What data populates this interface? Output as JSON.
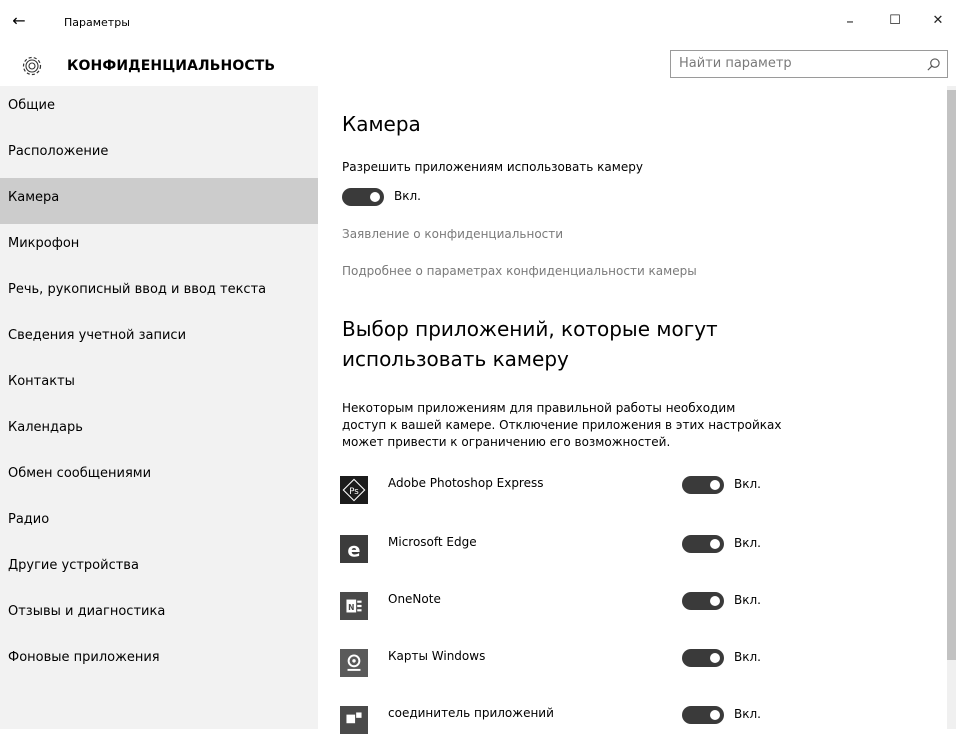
{
  "window": {
    "title": "Параметры",
    "back_glyph": "←",
    "min_glyph": "–",
    "max_glyph": "☐",
    "close_glyph": "✕"
  },
  "header": {
    "heading": "КОНФИДЕНЦИАЛЬНОСТЬ",
    "search_placeholder": "Найти параметр"
  },
  "sidebar": {
    "selected": "Камера",
    "items": [
      {
        "label": "Общие"
      },
      {
        "label": "Расположение"
      },
      {
        "label": "Камера"
      },
      {
        "label": "Микрофон"
      },
      {
        "label": "Речь, рукописный ввод и ввод текста"
      },
      {
        "label": "Сведения учетной записи"
      },
      {
        "label": "Контакты"
      },
      {
        "label": "Календарь"
      },
      {
        "label": "Обмен сообщениями"
      },
      {
        "label": "Радио"
      },
      {
        "label": "Другие устройства"
      },
      {
        "label": "Отзывы и диагностика"
      },
      {
        "label": "Фоновые приложения"
      }
    ]
  },
  "content": {
    "title": "Камера",
    "allow_label": "Разрешить приложениям использовать камеру",
    "allow_state": "Вкл.",
    "privacy_link": "Заявление о конфиденциальности",
    "more_link": "Подробнее о параметрах конфиденциальности камеры",
    "choose_title": "Выбор приложений, которые могут использовать камеру",
    "description": "Некоторым приложениям для правильной работы необходим доступ к вашей камере. Отключение приложения в этих настройках может привести к ограничению его возможностей.",
    "apps": [
      {
        "name": "Adobe Photoshop Express",
        "state": "Вкл.",
        "icon": "photoshop-icon"
      },
      {
        "name": "Microsoft Edge",
        "state": "Вкл.",
        "icon": "edge-icon"
      },
      {
        "name": "OneNote",
        "state": "Вкл.",
        "icon": "onenote-icon"
      },
      {
        "name": "Карты Windows",
        "state": "Вкл.",
        "icon": "maps-icon"
      },
      {
        "name": "соединитель приложений",
        "state": "Вкл.",
        "icon": "app-connector-icon"
      }
    ]
  },
  "colors": {
    "sidebar_bg": "#f2f2f2",
    "selected_bg": "#cccccc",
    "toggle_on": "#3a3a3a",
    "link": "#7a7a7a"
  }
}
